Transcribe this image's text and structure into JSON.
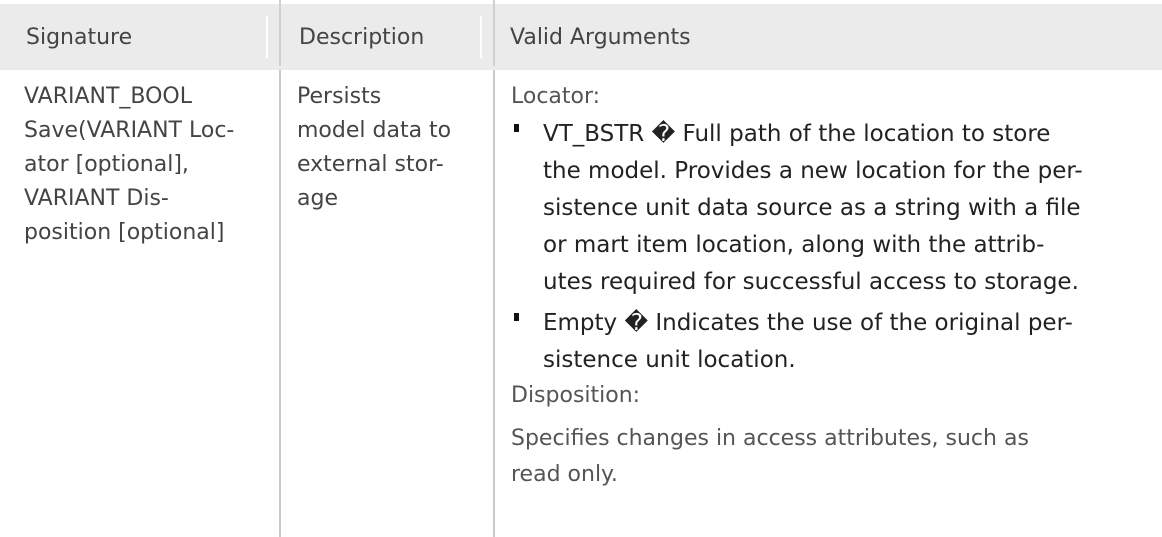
{
  "table": {
    "headers": [
      "Signature",
      "Description",
      "Valid Arguments"
    ],
    "row": {
      "signature_lines": [
        "VARIANT_BOOL",
        "Save(VARIANT Loc-",
        "ator [optional],",
        "VARIANT Dis-",
        "position [optional]"
      ],
      "description_lines": [
        "Persists",
        "model data to",
        "external stor-",
        "age"
      ],
      "arguments": {
        "locator_label": "Locator:",
        "bullets": [
          {
            "lines": [
              "VT_BSTR � Full path of the location to store",
              "the model. Provides a new location for the per-",
              "sistence unit data source as a string with a file",
              "or mart item location, along with the attrib-",
              "utes required for successful access to storage."
            ]
          },
          {
            "lines": [
              "Empty � Indicates the use of the original per-",
              "sistence unit location."
            ]
          }
        ],
        "disposition_label": "Disposition:",
        "disposition_lines": [
          "Specifies changes in access attributes, such as",
          "read only."
        ]
      }
    }
  }
}
